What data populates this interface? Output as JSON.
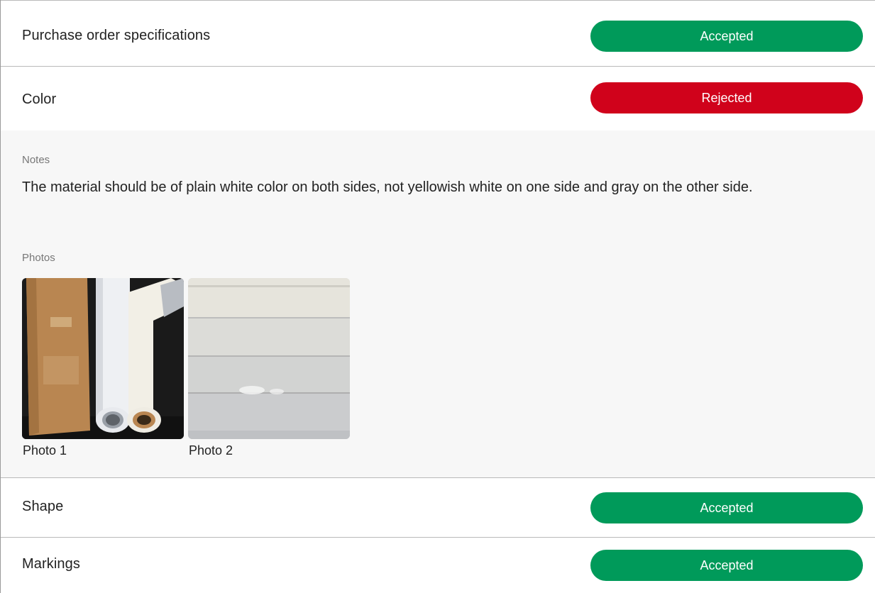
{
  "items": [
    {
      "label": "Purchase order specifications",
      "status": "Accepted"
    },
    {
      "label": "Color",
      "status": "Rejected"
    },
    {
      "label": "Shape",
      "status": "Accepted"
    },
    {
      "label": "Markings",
      "status": "Accepted"
    }
  ],
  "details": {
    "notes_label": "Notes",
    "notes_text": "The material should be of plain white color on both sides, not yellowish white on one side and gray on the other side.",
    "photos_label": "Photos",
    "photos": [
      {
        "caption": "Photo 1"
      },
      {
        "caption": "Photo 2"
      }
    ]
  },
  "colors": {
    "accepted": "#009a5a",
    "rejected": "#d0021b"
  }
}
